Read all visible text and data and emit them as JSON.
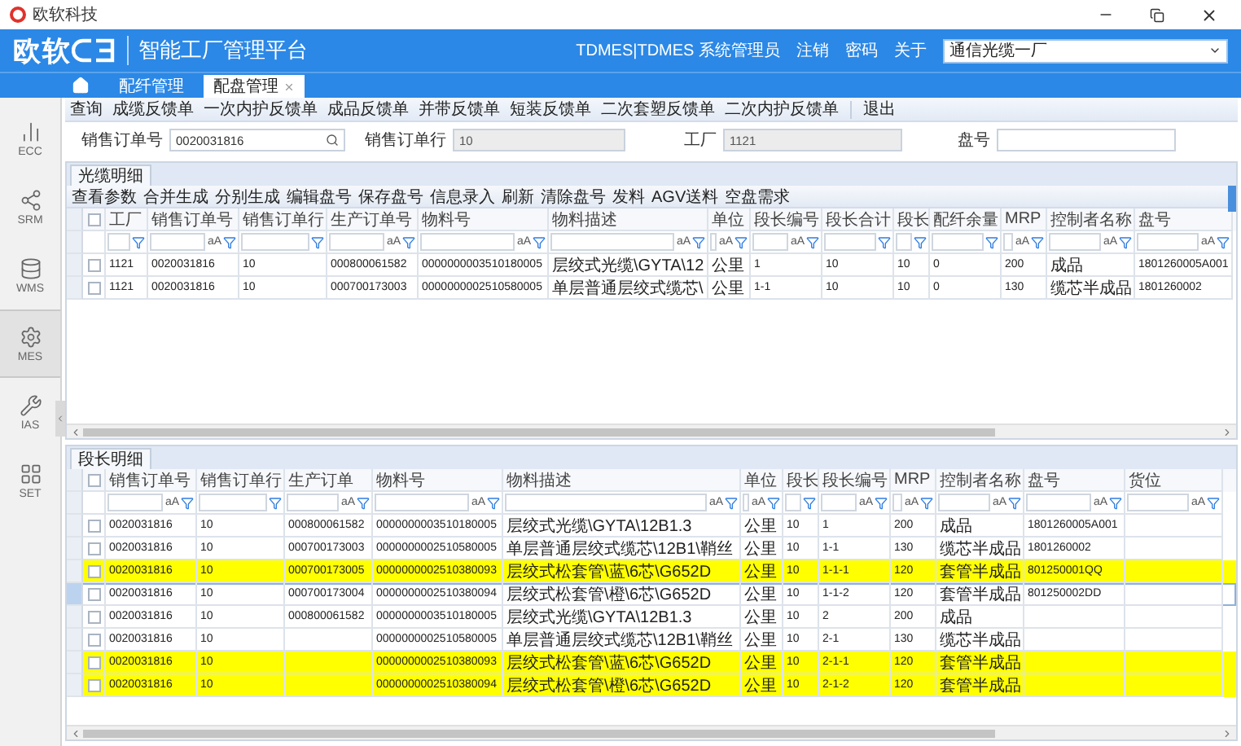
{
  "title_bar": {
    "app_name": "欧软科技"
  },
  "header": {
    "brand": "欧软",
    "platform": "智能工厂管理平台",
    "user": "TDMES|TDMES 系统管理员",
    "links": [
      "注销",
      "密码",
      "关于"
    ],
    "factory_select": "通信光缆一厂"
  },
  "tabs": [
    {
      "label": "配纤管理",
      "selected": false,
      "closable": false
    },
    {
      "label": "配盘管理",
      "selected": true,
      "closable": true
    }
  ],
  "sidebar": {
    "items": [
      {
        "label": "ECC",
        "selected": false
      },
      {
        "label": "SRM",
        "selected": false
      },
      {
        "label": "WMS",
        "selected": false
      },
      {
        "label": "MES",
        "selected": true
      },
      {
        "label": "IAS",
        "selected": false
      },
      {
        "label": "SET",
        "selected": false
      }
    ]
  },
  "menu": [
    "查询",
    "成缆反馈单",
    "一次内护反馈单",
    "成品反馈单",
    "并带反馈单",
    "短装反馈单",
    "二次套塑反馈单",
    "二次内护反馈单",
    "退出"
  ],
  "form": [
    {
      "label": "销售订单号",
      "value": "0020031816",
      "disabled": false,
      "search": true
    },
    {
      "label": "销售订单行",
      "value": "10",
      "disabled": true,
      "search": false
    },
    {
      "label": "工厂",
      "value": "1121",
      "disabled": true,
      "search": false
    },
    {
      "label": "盘号",
      "disabled": false,
      "search": false
    }
  ],
  "upper_panel": {
    "tab": "光缆明细",
    "toolbar": [
      "查看参数",
      "合并生成",
      "分别生成",
      "编辑盘号",
      "保存盘号",
      "信息录入",
      "刷新",
      "清除盘号",
      "发料",
      "AGV送料",
      "空盘需求"
    ],
    "table": {
      "all_checked": false,
      "columns": [
        {
          "label": "工厂",
          "kind": "code"
        },
        {
          "label": "销售订单号",
          "kind": "code",
          "case_toggle": "aA"
        },
        {
          "label": "销售订单行",
          "kind": "code"
        },
        {
          "label": "生产订单号",
          "kind": "code",
          "case_toggle": "aA"
        },
        {
          "label": "物料号",
          "kind": "code",
          "case_toggle": "aA"
        },
        {
          "label": "物料描述",
          "kind": "text",
          "case_toggle": "aA"
        },
        {
          "label": "单位",
          "kind": "text",
          "case_toggle": "aA"
        },
        {
          "label": "段长编号",
          "kind": "code",
          "case_toggle": "aA"
        },
        {
          "label": "段长合计",
          "kind": "code"
        },
        {
          "label": "段长",
          "kind": "code"
        },
        {
          "label": "配纤余量",
          "kind": "code"
        },
        {
          "label": "MRP",
          "kind": "code",
          "case_toggle": "aA"
        },
        {
          "label": "控制者名称",
          "kind": "text",
          "case_toggle": "aA"
        },
        {
          "label": "盘号",
          "kind": "code",
          "case_toggle": "aA"
        }
      ],
      "rows": [
        {
          "checked": false,
          "cells": [
            "1121",
            "0020031816",
            "10",
            "000800061582",
            "0000000003510180005",
            "层绞式光缆\\GYTA\\12",
            "公里",
            "1",
            "10",
            "10",
            "0",
            "200",
            "成品",
            "1801260005A001"
          ]
        },
        {
          "checked": false,
          "cells": [
            "1121",
            "0020031816",
            "10",
            "000700173003",
            "0000000002510580005",
            "单层普通层绞式缆芯\\",
            "公里",
            "1-1",
            "10",
            "10",
            "0",
            "130",
            "缆芯半成品",
            "1801260002"
          ]
        }
      ]
    }
  },
  "lower_panel": {
    "tab": "段长明细",
    "table": {
      "all_checked": false,
      "columns": [
        {
          "label": "销售订单号",
          "kind": "code",
          "case_toggle": "aA"
        },
        {
          "label": "销售订单行",
          "kind": "code"
        },
        {
          "label": "生产订单",
          "kind": "code",
          "case_toggle": "aA"
        },
        {
          "label": "物料号",
          "kind": "code",
          "case_toggle": "aA"
        },
        {
          "label": "物料描述",
          "kind": "text",
          "case_toggle": "aA"
        },
        {
          "label": "单位",
          "kind": "text",
          "case_toggle": "aA"
        },
        {
          "label": "段长",
          "kind": "code"
        },
        {
          "label": "段长编号",
          "kind": "code",
          "case_toggle": "aA"
        },
        {
          "label": "MRP",
          "kind": "code",
          "case_toggle": "aA"
        },
        {
          "label": "控制者名称",
          "kind": "text",
          "case_toggle": "aA"
        },
        {
          "label": "盘号",
          "kind": "code",
          "case_toggle": "aA"
        },
        {
          "label": "货位",
          "case_toggle": "aA"
        }
      ],
      "rows": [
        {
          "checked": false,
          "highlighted": false,
          "selected": false,
          "cells": [
            "0020031816",
            "10",
            "000800061582",
            "0000000003510180005",
            "层绞式光缆\\GYTA\\12B1.3",
            "公里",
            "10",
            "1",
            "200",
            "成品",
            "1801260005A001",
            null
          ]
        },
        {
          "checked": false,
          "highlighted": false,
          "selected": false,
          "cells": [
            "0020031816",
            "10",
            "000700173003",
            "0000000002510580005",
            "单层普通层绞式缆芯\\12B1\\鞘丝",
            "公里",
            "10",
            "1-1",
            "130",
            "缆芯半成品",
            "1801260002",
            null
          ]
        },
        {
          "checked": false,
          "highlighted": true,
          "selected": false,
          "cells": [
            "0020031816",
            "10",
            "000700173005",
            "0000000002510380093",
            "层绞式松套管\\蓝\\6芯\\G652D",
            "公里",
            "10",
            "1-1-1",
            "120",
            "套管半成品",
            "801250001QQ",
            null
          ]
        },
        {
          "checked": false,
          "highlighted": false,
          "selected": true,
          "cells": [
            "0020031816",
            "10",
            "000700173004",
            "0000000002510380094",
            "层绞式松套管\\橙\\6芯\\G652D",
            "公里",
            "10",
            "1-1-2",
            "120",
            "套管半成品",
            "801250002DD",
            null
          ]
        },
        {
          "checked": false,
          "highlighted": false,
          "selected": false,
          "cells": [
            "0020031816",
            "10",
            "000800061582",
            "0000000003510180005",
            "层绞式光缆\\GYTA\\12B1.3",
            "公里",
            "10",
            "2",
            "200",
            "成品",
            null,
            null
          ]
        },
        {
          "checked": false,
          "highlighted": false,
          "selected": false,
          "cells": [
            "0020031816",
            "10",
            null,
            "0000000002510580005",
            "单层普通层绞式缆芯\\12B1\\鞘丝",
            "公里",
            "10",
            "2-1",
            "130",
            "缆芯半成品",
            null,
            null
          ]
        },
        {
          "checked": false,
          "highlighted": true,
          "selected": false,
          "cells": [
            "0020031816",
            "10",
            null,
            "0000000002510380093",
            "层绞式松套管\\蓝\\6芯\\G652D",
            "公里",
            "10",
            "2-1-1",
            "120",
            "套管半成品",
            null,
            null
          ]
        },
        {
          "checked": false,
          "highlighted": true,
          "selected": false,
          "cells": [
            "0020031816",
            "10",
            null,
            "0000000002510380094",
            "层绞式松套管\\橙\\6芯\\G652D",
            "公里",
            "10",
            "2-1-2",
            "120",
            "套管半成品",
            null,
            null
          ]
        }
      ]
    }
  }
}
